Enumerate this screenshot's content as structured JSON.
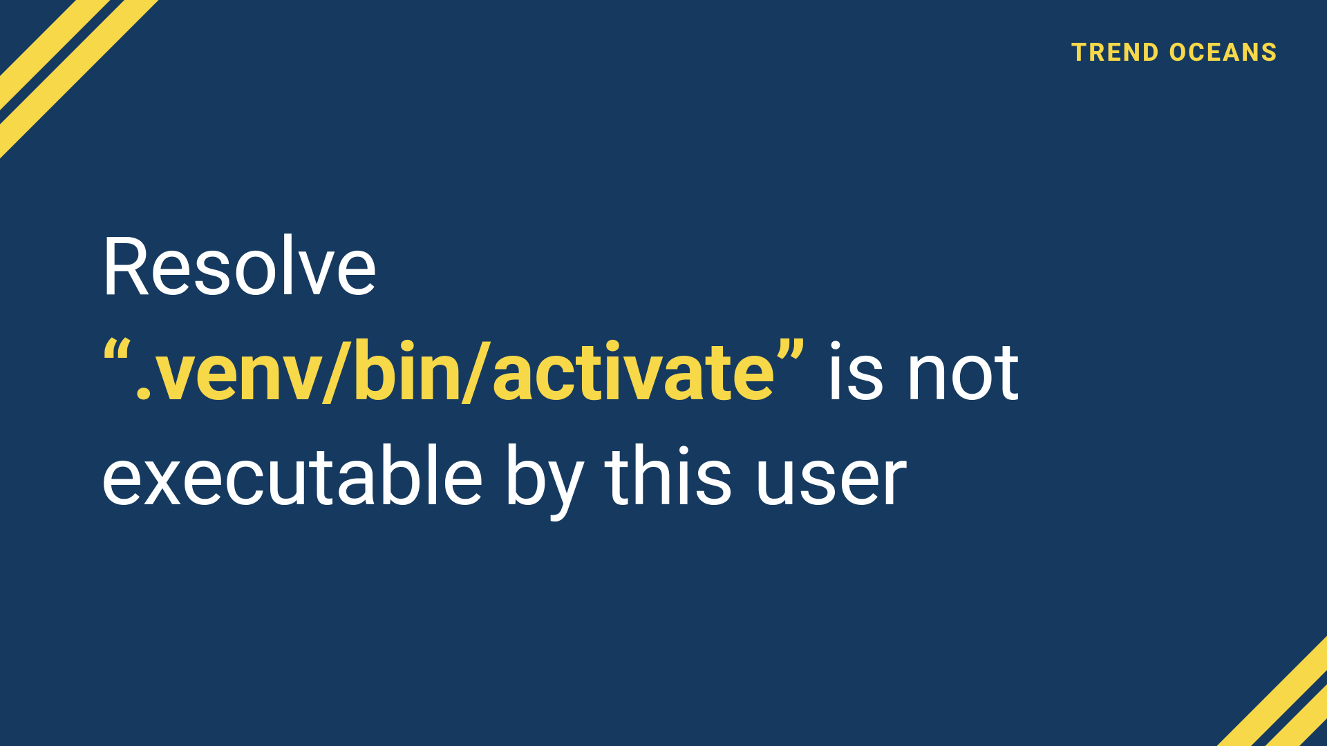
{
  "brand": "TREND OCEANS",
  "title": {
    "line1": "Resolve",
    "quote_open": "“",
    "highlighted": ".venv/bin/activate",
    "quote_close": "”",
    "line2_rest": " is not",
    "line3": "executable by this user"
  },
  "colors": {
    "background": "#163a5f",
    "accent": "#f7d849",
    "text": "#ffffff"
  }
}
